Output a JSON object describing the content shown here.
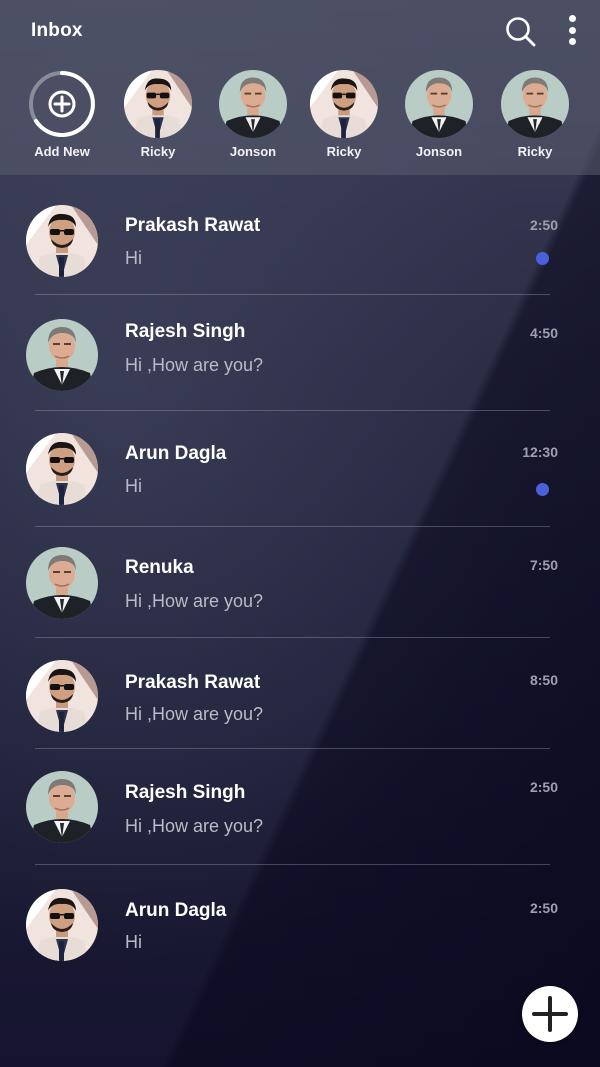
{
  "header": {
    "title": "Inbox",
    "search_icon": "search-icon",
    "menu_icon": "more-vertical-icon"
  },
  "stories": [
    {
      "label": "Add New",
      "type": "add",
      "icon": "plus-icon"
    },
    {
      "label": "Ricky",
      "avatar": "man-sunglasses"
    },
    {
      "label": "Jonson",
      "avatar": "man-suit"
    },
    {
      "label": "Ricky",
      "avatar": "man-sunglasses"
    },
    {
      "label": "Jonson",
      "avatar": "man-suit"
    },
    {
      "label": "Ricky",
      "avatar": "man-suit"
    }
  ],
  "conversations": [
    {
      "name": "Prakash Rawat",
      "message": "Hi",
      "time": "2:50",
      "unread": true,
      "avatar": "man-sunglasses"
    },
    {
      "name": "Rajesh Singh",
      "message": "Hi ,How are you?",
      "time": "4:50",
      "unread": false,
      "avatar": "man-suit"
    },
    {
      "name": "Arun Dagla",
      "message": "Hi",
      "time": "12:30",
      "unread": true,
      "avatar": "man-sunglasses"
    },
    {
      "name": "Renuka",
      "message": "Hi ,How are you?",
      "time": "7:50",
      "unread": false,
      "avatar": "man-suit"
    },
    {
      "name": "Prakash Rawat",
      "message": "Hi ,How are you?",
      "time": "8:50",
      "unread": false,
      "avatar": "man-sunglasses"
    },
    {
      "name": "Rajesh Singh",
      "message": "Hi ,How are you?",
      "time": "2:50",
      "unread": false,
      "avatar": "man-suit"
    },
    {
      "name": "Arun Dagla",
      "message": "Hi",
      "time": "2:50",
      "unread": false,
      "avatar": "man-sunglasses"
    }
  ],
  "fab": {
    "icon": "plus-icon"
  },
  "colors": {
    "unread_dot": "#4b61d9",
    "header_bg": "#5a5c70",
    "background": "#20213a"
  }
}
